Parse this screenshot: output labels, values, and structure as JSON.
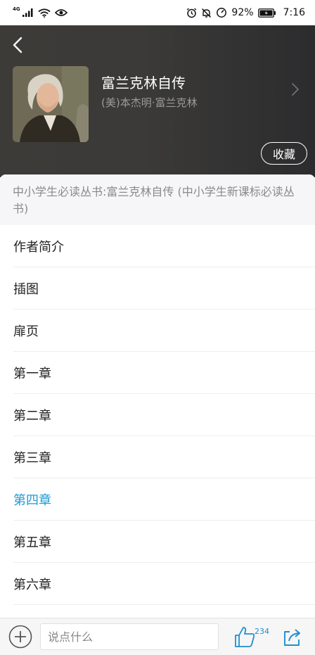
{
  "status_bar": {
    "network": "4G",
    "battery_percent": "92%",
    "time": "7:16"
  },
  "header": {
    "book_title": "富兰克林自传",
    "author": "(美)本杰明·富兰克林",
    "favorite_label": "收藏"
  },
  "series_title": "中小学生必读丛书:富兰克林自传 (中小学生新课标必读丛书)",
  "toc": {
    "active_index": 6,
    "items": [
      "作者简介",
      "插图",
      "扉页",
      "第一章",
      "第二章",
      "第三章",
      "第四章",
      "第五章",
      "第六章"
    ]
  },
  "bottom_bar": {
    "comment_placeholder": "说点什么",
    "like_count": "234"
  },
  "colors": {
    "accent": "#1f9ad6",
    "header_bg": "#3b3a38"
  }
}
